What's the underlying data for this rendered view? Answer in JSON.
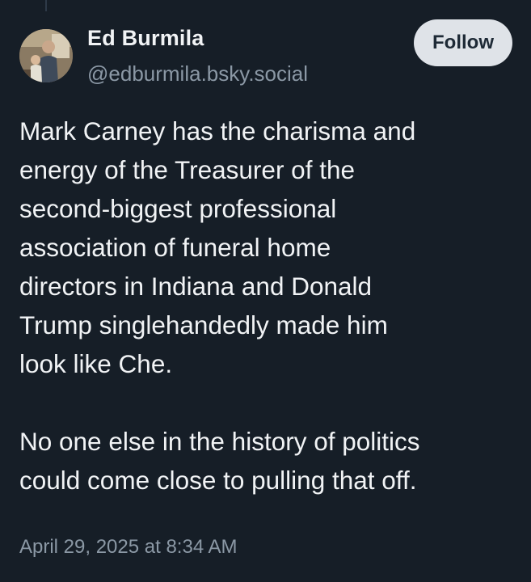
{
  "author": {
    "name": "Ed Burmila",
    "handle": "@edburmila.bsky.social",
    "avatar_icon": "profile-photo"
  },
  "actions": {
    "follow_label": "Follow"
  },
  "post": {
    "paragraphs": [
      "Mark Carney has the charisma and\nenergy of the Treasurer of the\nsecond-biggest professional\nassociation of funeral home\ndirectors in Indiana and Donald\nTrump singlehandedly made him\nlook like Che.",
      "No one else in the history of politics\ncould come close to pulling that off."
    ],
    "timestamp": "April 29, 2025 at 8:34 AM"
  },
  "colors": {
    "background": "#161e27",
    "text": "#f1f3f5",
    "muted": "#8b98a5",
    "button_bg": "#dfe3e8",
    "button_text": "#1e2a36"
  }
}
